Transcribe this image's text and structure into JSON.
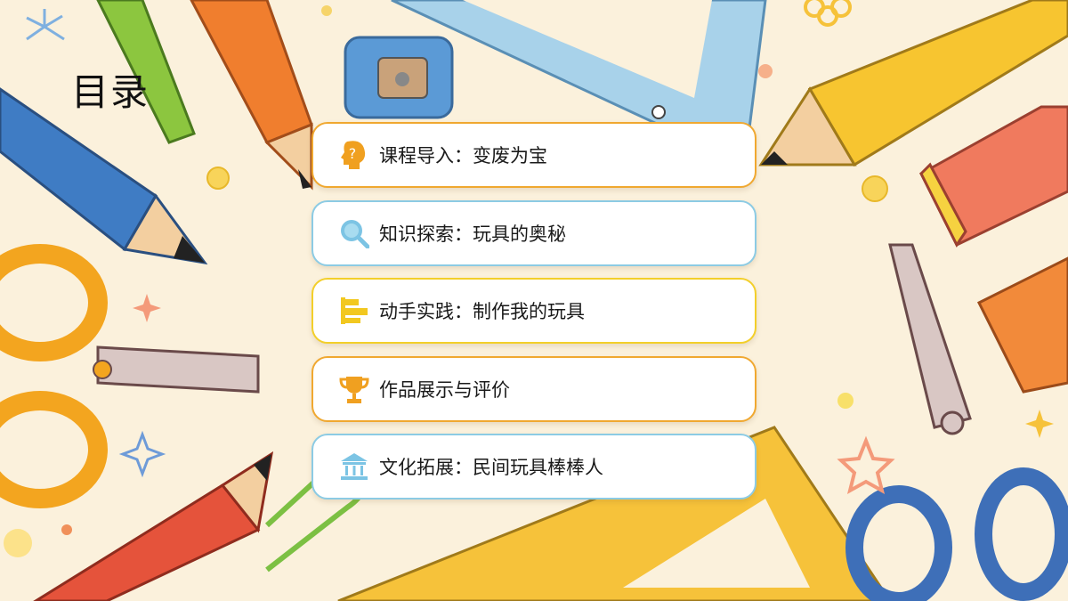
{
  "slide": {
    "title": "目录",
    "items": [
      {
        "label": "课程导入：变废为宝",
        "icon": "lightbulb-head-icon",
        "border": "#f0a830",
        "icon_color": "#f0a020"
      },
      {
        "label": "知识探索：玩具的奥秘",
        "icon": "magnifier-icon",
        "border": "#8ccbe4",
        "icon_color": "#7cc4e4"
      },
      {
        "label": "动手实践：制作我的玩具",
        "icon": "tools-icon",
        "border": "#f3cf2a",
        "icon_color": "#f2c820"
      },
      {
        "label": "作品展示与评价",
        "icon": "trophy-icon",
        "border": "#f0a830",
        "icon_color": "#f0a020"
      },
      {
        "label": "文化拓展：民间玩具棒棒人",
        "icon": "temple-icon",
        "border": "#8ccbe4",
        "icon_color": "#7cc4e4"
      }
    ]
  }
}
